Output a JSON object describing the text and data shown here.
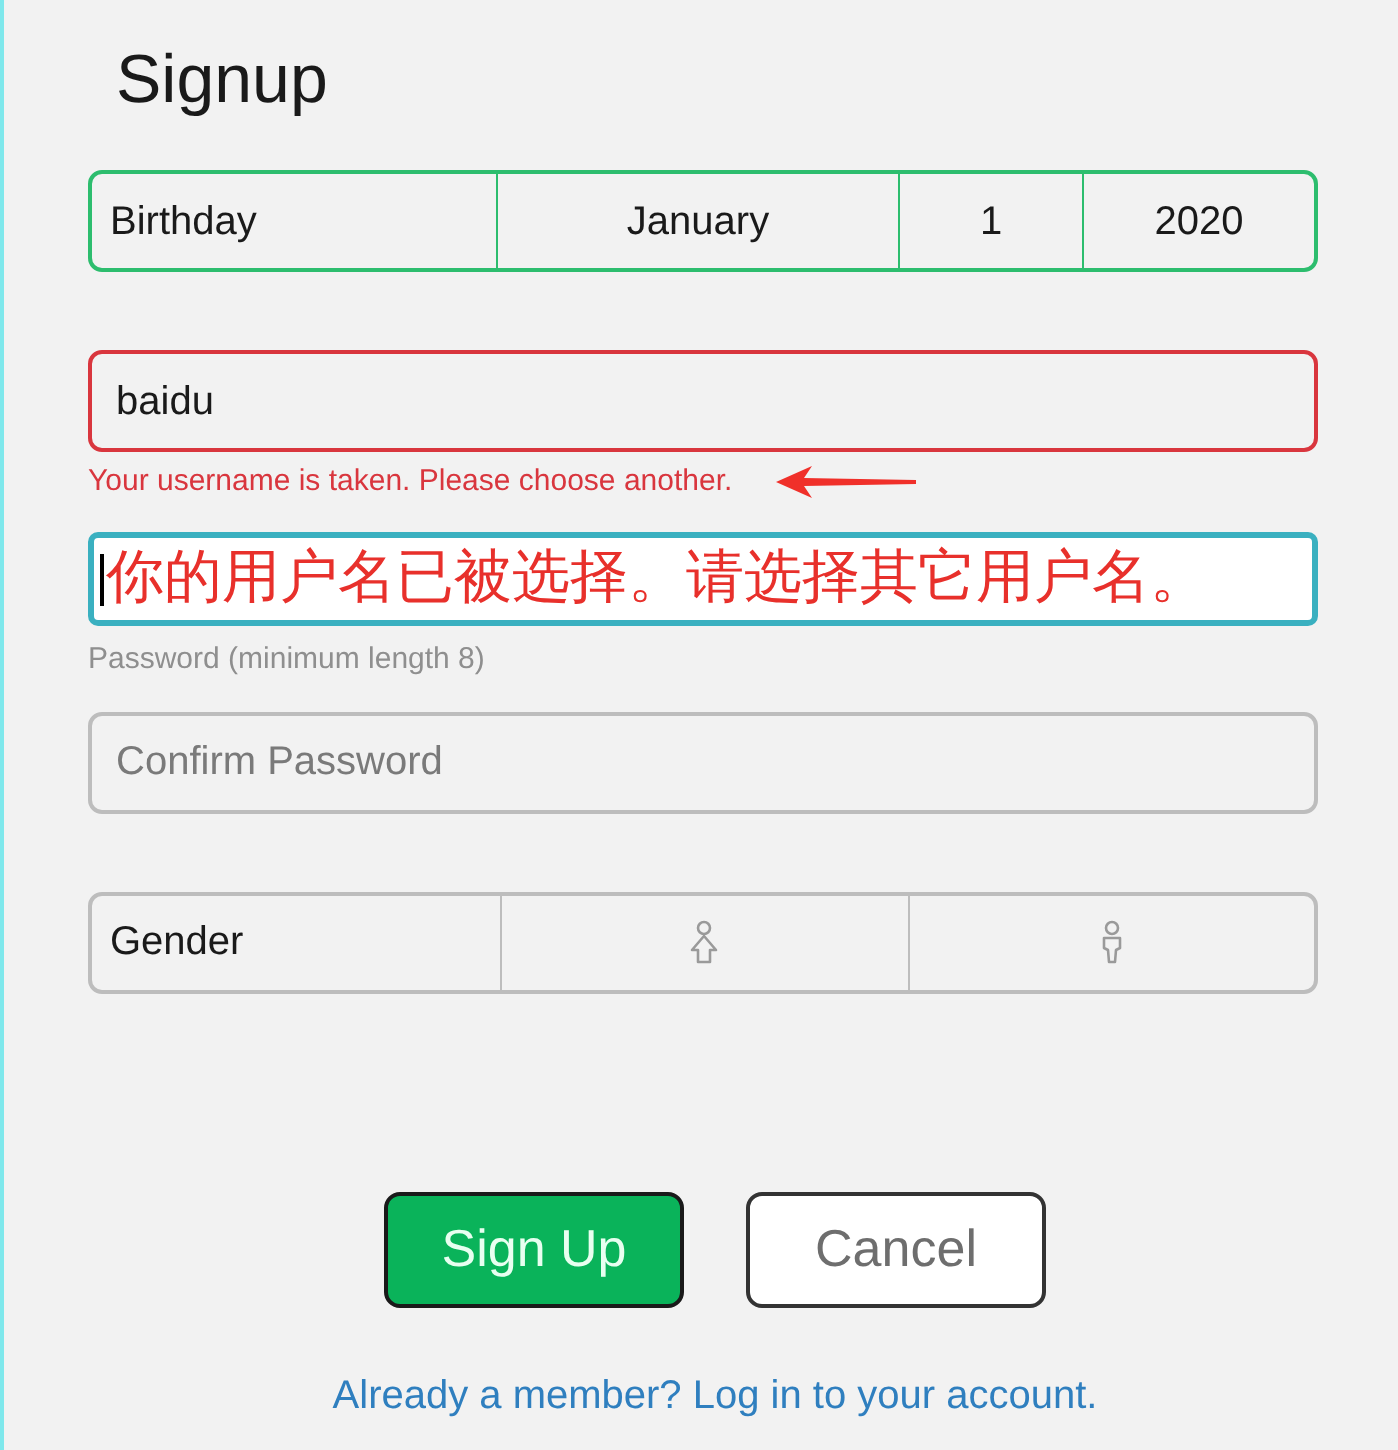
{
  "title": "Signup",
  "birthday": {
    "label": "Birthday",
    "month": "January",
    "day": "1",
    "year": "2020",
    "valid": true
  },
  "username": {
    "value": "baidu",
    "error": "Your username is taken. Please choose another."
  },
  "password": {
    "focused": true,
    "annotation": "你的用户名已被选择。请选择其它用户名。",
    "hint": "Password (minimum length 8)"
  },
  "confirm_password": {
    "placeholder": "Confirm Password"
  },
  "gender": {
    "label": "Gender",
    "options": [
      {
        "kind": "female",
        "selected": false
      },
      {
        "kind": "male",
        "selected": false
      }
    ]
  },
  "buttons": [
    {
      "label": "Sign Up",
      "kind": "primary"
    },
    {
      "label": "Cancel",
      "kind": "secondary"
    }
  ],
  "login_link": "Already a member? Log in to your account."
}
